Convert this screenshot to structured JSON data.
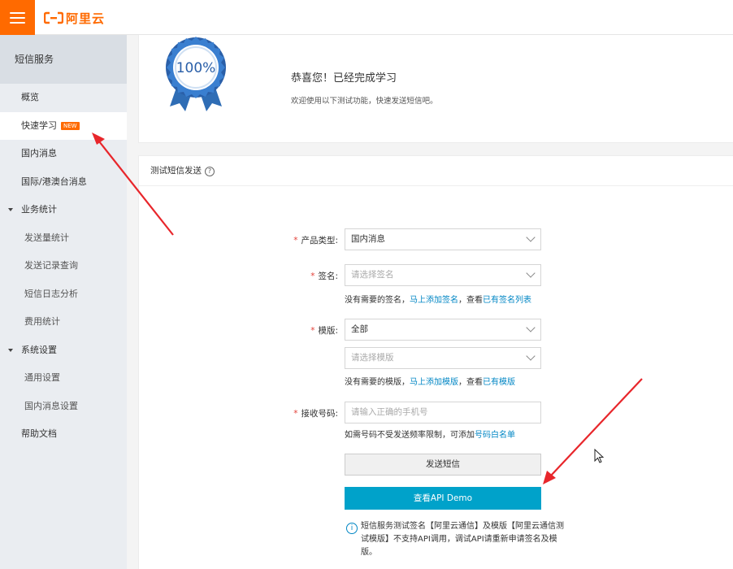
{
  "header": {
    "logo_text": "阿里云",
    "brand_color": "#ff6a00"
  },
  "sidebar": {
    "title": "短信服务",
    "items": [
      {
        "label": "概览"
      },
      {
        "label": "快速学习",
        "badge": "NEW"
      },
      {
        "label": "国内消息"
      },
      {
        "label": "国际/港澳台消息"
      },
      {
        "label": "业务统计"
      },
      {
        "label": "发送量统计"
      },
      {
        "label": "发送记录查询"
      },
      {
        "label": "短信日志分析"
      },
      {
        "label": "费用统计"
      },
      {
        "label": "系统设置"
      },
      {
        "label": "通用设置"
      },
      {
        "label": "国内消息设置"
      },
      {
        "label": "帮助文档"
      }
    ]
  },
  "congrats": {
    "badge_text": "100%",
    "title": "恭喜您！已经完成学习",
    "subtitle": "欢迎使用以下测试功能，快速发送短信吧。"
  },
  "form": {
    "section_title": "测试短信发送",
    "help_glyph": "?",
    "product_type": {
      "label": "产品类型:",
      "value": "国内消息"
    },
    "signature": {
      "label": "签名:",
      "placeholder": "请选择签名",
      "hint_prefix": "没有需要的签名，",
      "hint_link1": "马上添加签名",
      "hint_mid": "，查看",
      "hint_link2": "已有签名列表"
    },
    "template": {
      "label": "模版:",
      "value": "全部",
      "placeholder": "请选择模版",
      "hint_prefix": "没有需要的模版，",
      "hint_link1": "马上添加模版",
      "hint_mid": "，查看",
      "hint_link2": "已有模版"
    },
    "phone": {
      "label": "接收号码:",
      "placeholder": "请输入正确的手机号",
      "hint_prefix": "如需号码不受发送频率限制，可添加",
      "hint_link": "号码白名单"
    },
    "required_mark": "*",
    "send_button": "发送短信",
    "demo_button": "查看API Demo",
    "info_glyph": "i",
    "info_text": "短信服务测试签名【阿里云通信】及模版【阿里云通信测试模版】不支持API调用，调试API请重新申请签名及模版。"
  },
  "colors": {
    "accent": "#ff6a00",
    "link": "#0086c4",
    "primary_button": "#00a2ca",
    "annotation_arrow": "#e8262b"
  }
}
